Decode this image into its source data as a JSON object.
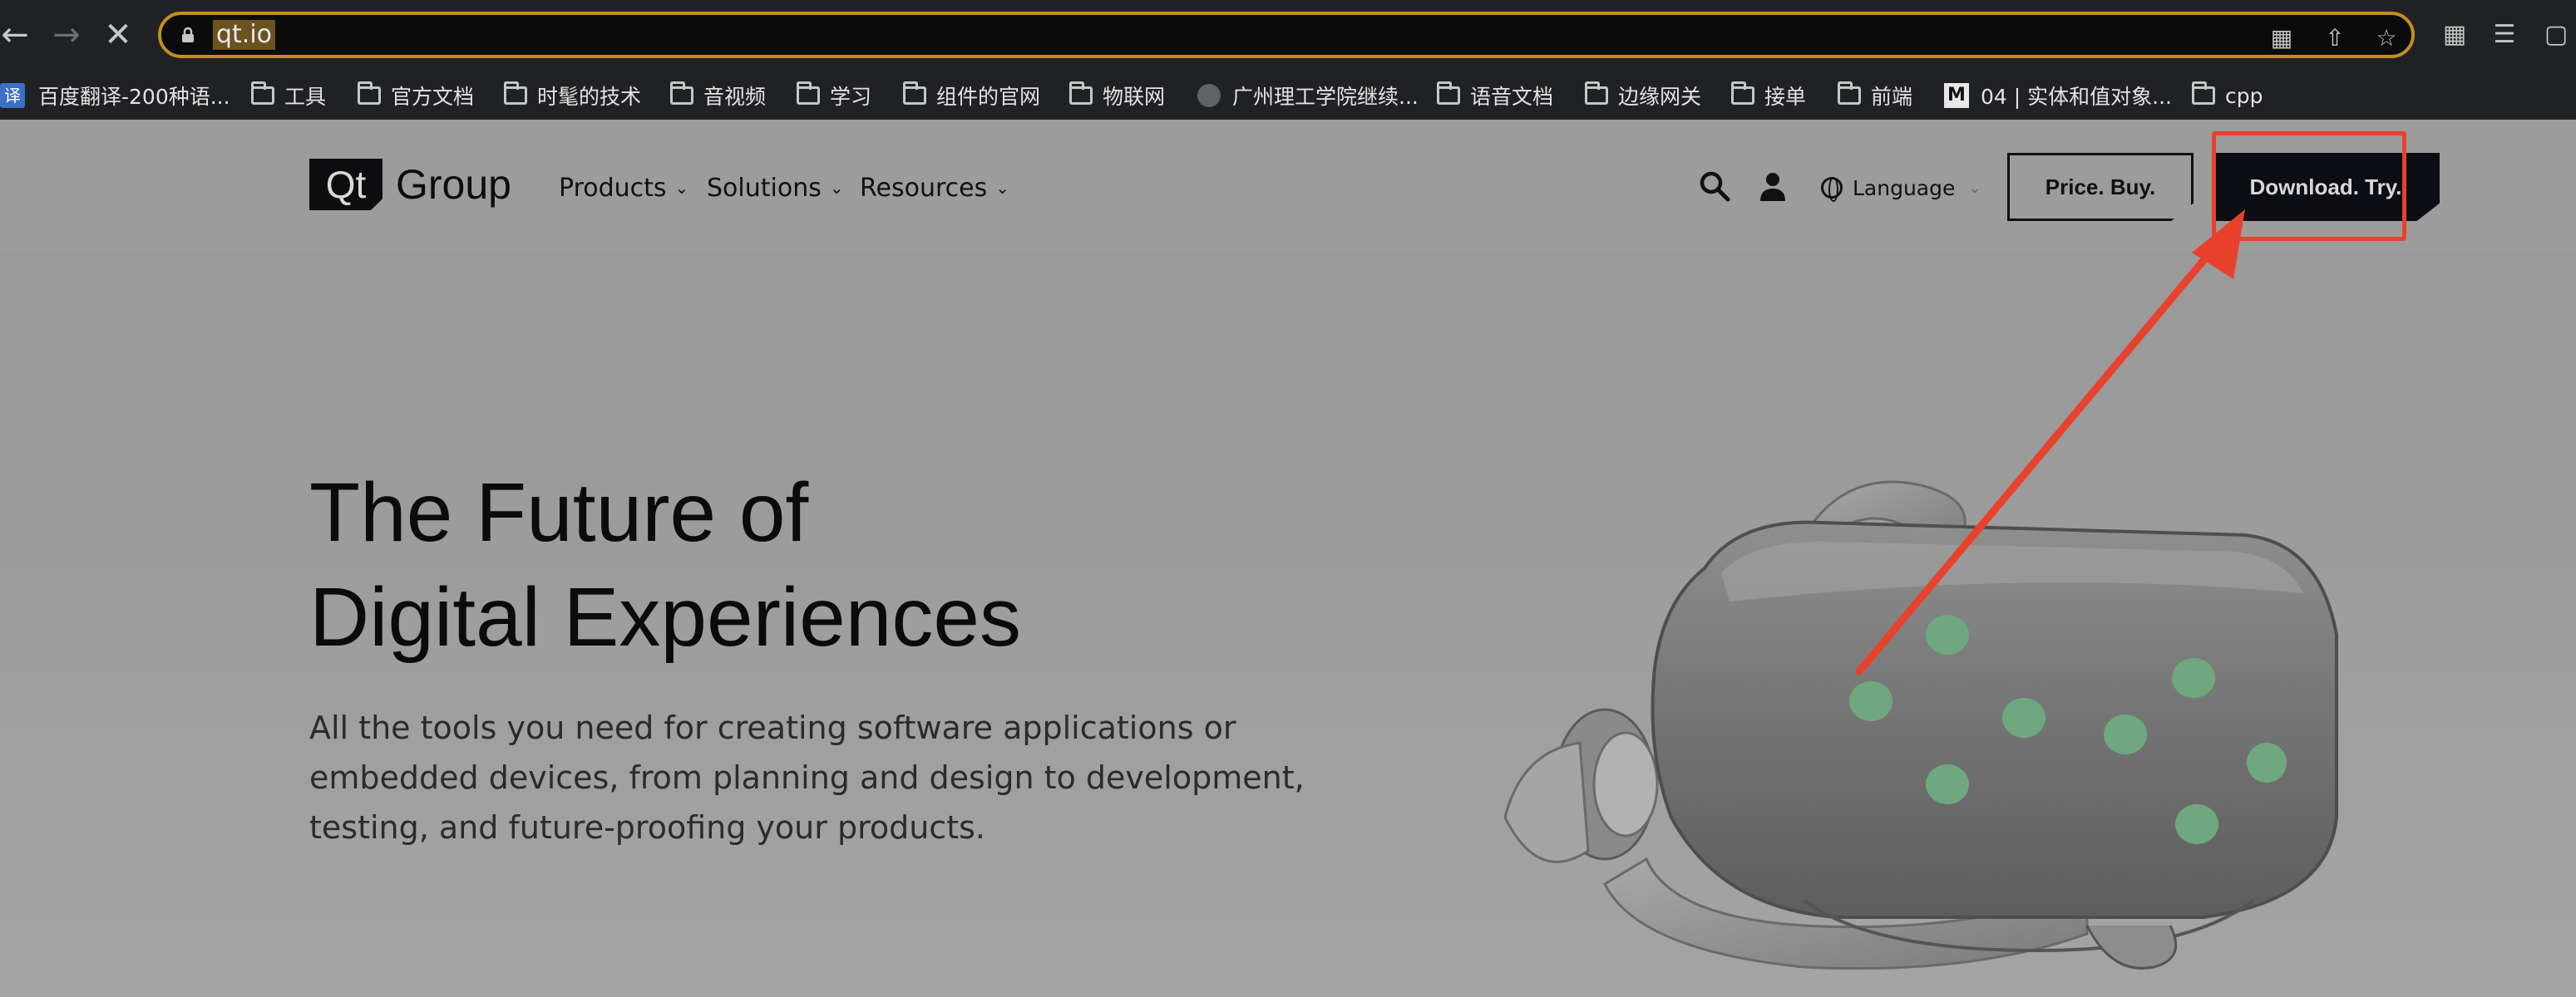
{
  "browser": {
    "url": "qt.io",
    "nav": {
      "back_icon": "back-arrow-icon",
      "forward_icon": "forward-arrow-icon",
      "stop_icon": "close-icon"
    },
    "bookmarks": [
      {
        "label": "百度翻译-200种语...",
        "icon": "baidu-translate-icon"
      },
      {
        "label": "工具",
        "icon": "folder-icon"
      },
      {
        "label": "官方文档",
        "icon": "folder-icon"
      },
      {
        "label": "时髦的技术",
        "icon": "folder-icon"
      },
      {
        "label": "音视频",
        "icon": "folder-icon"
      },
      {
        "label": "学习",
        "icon": "folder-icon"
      },
      {
        "label": "组件的官网",
        "icon": "folder-icon"
      },
      {
        "label": "物联网",
        "icon": "folder-icon"
      },
      {
        "label": "广州理工学院继续...",
        "icon": "globe-icon"
      },
      {
        "label": "语音文档",
        "icon": "folder-icon"
      },
      {
        "label": "边缘网关",
        "icon": "folder-icon"
      },
      {
        "label": "接单",
        "icon": "folder-icon"
      },
      {
        "label": "前端",
        "icon": "folder-icon"
      },
      {
        "label": "04 | 实体和值对象...",
        "icon": "m-site-icon"
      },
      {
        "label": "cpp",
        "icon": "folder-icon"
      }
    ]
  },
  "site": {
    "logo_mark": "Qt",
    "logo_text": "Group",
    "menu": [
      {
        "label": "Products"
      },
      {
        "label": "Solutions"
      },
      {
        "label": "Resources"
      }
    ],
    "language_label": "Language",
    "price_button": "Price. Buy.",
    "download_button": "Download. Try."
  },
  "hero": {
    "title_line1": "The Future of",
    "title_line2": "Digital Experiences",
    "subtitle": "All the tools you need for creating software applications or embedded devices, from planning and design to development, testing, and future-proofing your products."
  },
  "colors": {
    "annotation": "#e8412c",
    "omnibox_border": "#c28f1e",
    "page_bg": "#9c9c9c",
    "vr_dots": "#6fa87f"
  }
}
